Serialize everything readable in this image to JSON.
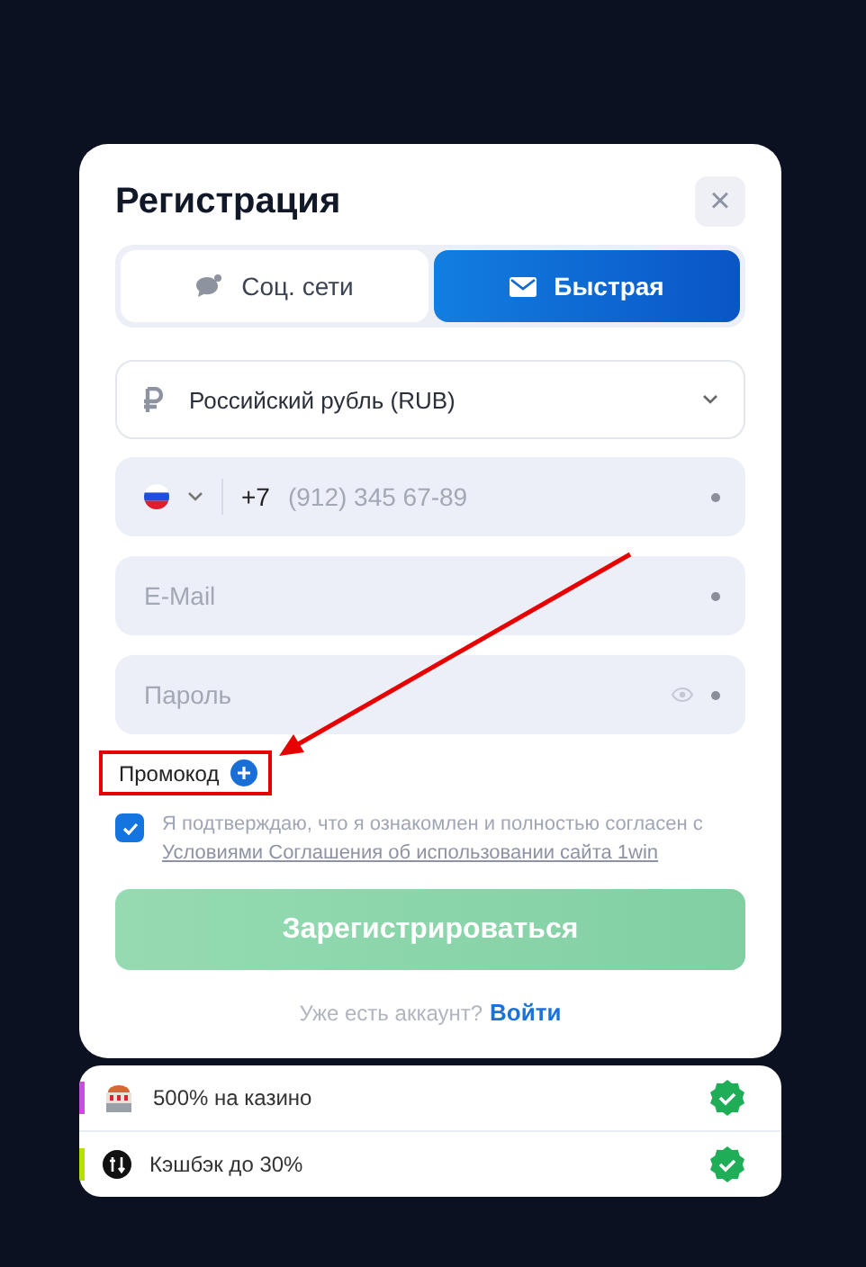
{
  "dialog": {
    "title": "Регистрация",
    "close": "×"
  },
  "tabs": [
    {
      "kind": "social",
      "label": "Соц. сети",
      "selected": false
    },
    {
      "kind": "quick",
      "label": "Быстрая",
      "selected": true
    }
  ],
  "currency": {
    "value": "Российский рубль (RUB)"
  },
  "phone": {
    "code": "+7",
    "placeholder": "(912) 345 67-89"
  },
  "email": {
    "placeholder": "E-Mail"
  },
  "password": {
    "placeholder": "Пароль"
  },
  "promo": {
    "label": "Промокод",
    "highlighted": true
  },
  "agreement": {
    "checked": true,
    "text": "Я подтверждаю, что я ознакомлен и полностью согласен с",
    "link": "Условиями Соглашения об использовании сайта 1win"
  },
  "submit": {
    "label": "Зарегистрироваться"
  },
  "login": {
    "prompt": "Уже есть аккаунт?",
    "link": "Войти"
  },
  "bonuses": [
    {
      "kind": "casino",
      "label": "500% на казино",
      "color": "#c84fd8",
      "checked": true
    },
    {
      "kind": "cashback",
      "label": "Кэшбэк до 30%",
      "color": "#b5e000",
      "checked": true
    }
  ]
}
